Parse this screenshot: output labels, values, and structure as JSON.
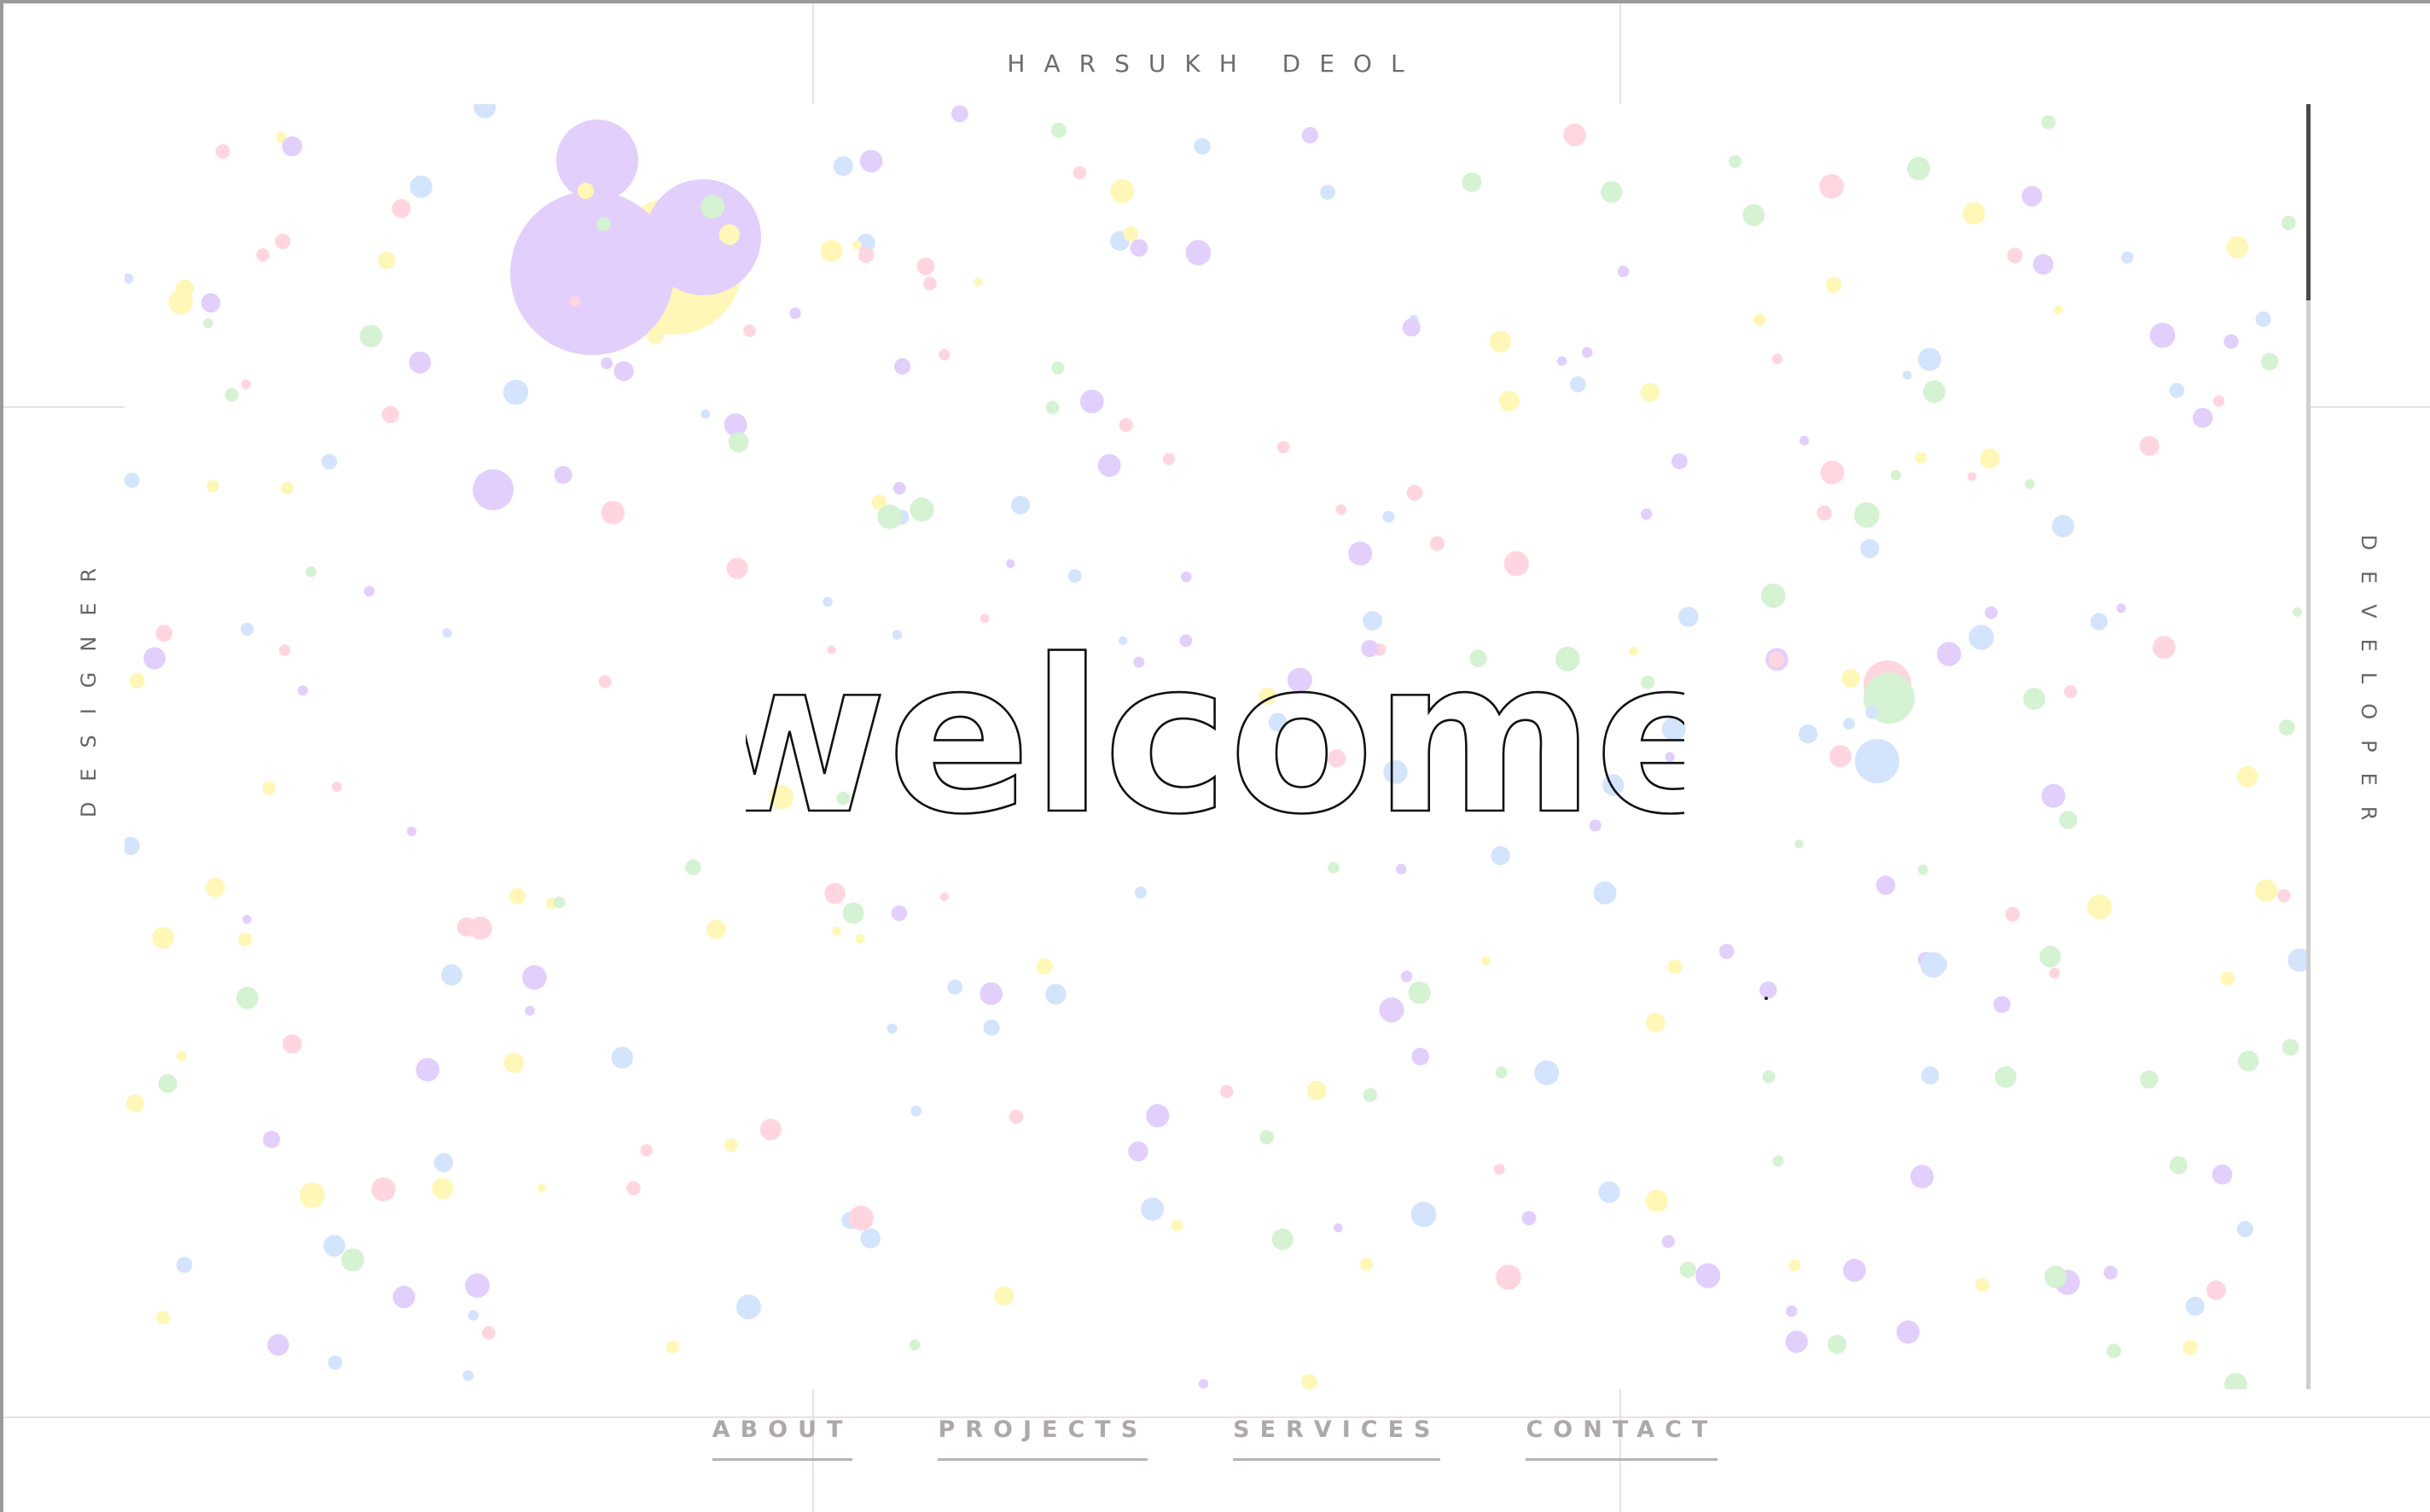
{
  "header": {
    "owner_name": "HARSUKH DEOL"
  },
  "sides": {
    "left_label": "DESIGNER",
    "right_label": "DEVELOPER"
  },
  "hero": {
    "heading": "welcome"
  },
  "nav": {
    "about": "ABOUT",
    "projects": "PROJECTS",
    "services": "SERVICES",
    "contact": "CONTACT"
  },
  "colors": {
    "background": "#ffffff",
    "text": "#666666",
    "nav_text": "#aea9a7",
    "bubble_purple": "#e2cffc",
    "bubble_yellow": "#fff7b8",
    "bubble_pink": "#ffd6df",
    "bubble_blue": "#d3e4fc",
    "bubble_green": "#d5f2d2"
  },
  "icons": {
    "bubbles": "confetti-bubbles-background"
  }
}
